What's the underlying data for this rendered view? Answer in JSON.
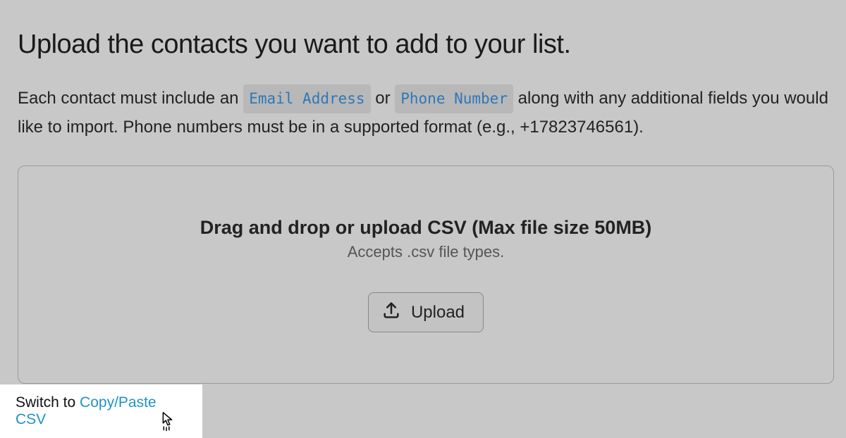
{
  "title": "Upload the contacts you want to add to your list.",
  "instructions": {
    "pre": "Each contact must include an ",
    "chip1": "Email Address",
    "mid": " or ",
    "chip2": "Phone Number",
    "post": " along with any additional fields you would like to import. Phone numbers must be in a supported format (e.g., +17823746561)."
  },
  "dropzone": {
    "title": "Drag and drop or upload CSV (Max file size 50MB)",
    "subtitle": "Accepts .csv file types.",
    "button_label": "Upload"
  },
  "switch": {
    "prefix": "Switch to ",
    "link": "Copy/Paste CSV"
  }
}
